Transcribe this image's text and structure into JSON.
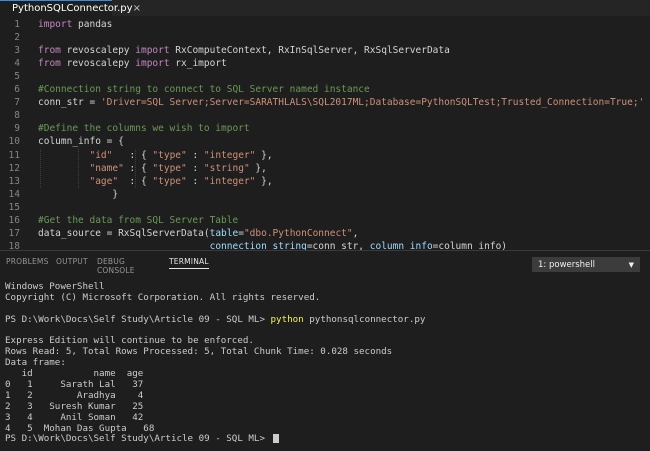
{
  "tab": {
    "title": "PythonSQLConnector.py",
    "close": "×"
  },
  "editor": {
    "line_numbers": [
      "1",
      "2",
      "3",
      "4",
      "5",
      "6",
      "7",
      "8",
      "9",
      "10",
      "11",
      "12",
      "13",
      "14",
      "15",
      "16",
      "17",
      "18"
    ],
    "lines": [
      [
        {
          "t": "import",
          "c": "kw"
        },
        {
          "t": " pandas",
          "c": ""
        }
      ],
      [],
      [
        {
          "t": "from",
          "c": "kw"
        },
        {
          "t": " revoscalepy ",
          "c": ""
        },
        {
          "t": "import",
          "c": "kw"
        },
        {
          "t": " RxComputeContext, RxInSqlServer, RxSqlServerData",
          "c": ""
        }
      ],
      [
        {
          "t": "from",
          "c": "kw"
        },
        {
          "t": " revoscalepy ",
          "c": ""
        },
        {
          "t": "import",
          "c": "kw"
        },
        {
          "t": " rx_import",
          "c": ""
        }
      ],
      [],
      [
        {
          "t": "#Connection string to connect to SQL Server named instance",
          "c": "cm"
        }
      ],
      [
        {
          "t": "conn_str = ",
          "c": ""
        },
        {
          "t": "'Driver=SQL Server;Server=SARATHLALS\\SQL2017ML;Database=PythonSQLTest;Trusted_Connection=True;'",
          "c": "str"
        }
      ],
      [],
      [
        {
          "t": "#Define the columns we wish to import",
          "c": "cm"
        }
      ],
      [
        {
          "t": "column_info = {",
          "c": ""
        }
      ],
      [
        {
          "t": "         ",
          "c": ""
        },
        {
          "t": "\"id\"",
          "c": "str"
        },
        {
          "t": "   : { ",
          "c": ""
        },
        {
          "t": "\"type\"",
          "c": "str"
        },
        {
          "t": " : ",
          "c": ""
        },
        {
          "t": "\"integer\"",
          "c": "str"
        },
        {
          "t": " },",
          "c": ""
        }
      ],
      [
        {
          "t": "         ",
          "c": ""
        },
        {
          "t": "\"name\"",
          "c": "str"
        },
        {
          "t": " : { ",
          "c": ""
        },
        {
          "t": "\"type\"",
          "c": "str"
        },
        {
          "t": " : ",
          "c": ""
        },
        {
          "t": "\"string\"",
          "c": "str"
        },
        {
          "t": " },",
          "c": ""
        }
      ],
      [
        {
          "t": "         ",
          "c": ""
        },
        {
          "t": "\"age\"",
          "c": "str"
        },
        {
          "t": "  : { ",
          "c": ""
        },
        {
          "t": "\"type\"",
          "c": "str"
        },
        {
          "t": " : ",
          "c": ""
        },
        {
          "t": "\"integer\"",
          "c": "str"
        },
        {
          "t": " },",
          "c": ""
        }
      ],
      [
        {
          "t": "             }",
          "c": ""
        }
      ],
      [],
      [
        {
          "t": "#Get the data from SQL Server Table",
          "c": "cm"
        }
      ],
      [
        {
          "t": "data_source = RxSqlServerData(",
          "c": ""
        },
        {
          "t": "table",
          "c": "par"
        },
        {
          "t": "=",
          "c": ""
        },
        {
          "t": "\"dbo.PythonConnect\"",
          "c": "str"
        },
        {
          "t": ",",
          "c": ""
        }
      ],
      [
        {
          "t": "                              ",
          "c": ""
        },
        {
          "t": "connection_string",
          "c": "par"
        },
        {
          "t": "=conn_str, ",
          "c": ""
        },
        {
          "t": "column_info",
          "c": "par"
        },
        {
          "t": "=column_info)",
          "c": ""
        }
      ]
    ]
  },
  "panel": {
    "tabs": [
      "PROBLEMS",
      "OUTPUT",
      "DEBUG CONSOLE",
      "TERMINAL"
    ],
    "active_tab": "TERMINAL",
    "terminal_select": "1: powershell",
    "terminal_lines": [
      "Windows PowerShell",
      "Copyright (C) Microsoft Corporation. All rights reserved.",
      "",
      "PS D:\\Work\\Docs\\Self Study\\Article 09 - SQL ML> ",
      "",
      "Express Edition will continue to be enforced.",
      "Rows Read: 5, Total Rows Processed: 5, Total Chunk Time: 0.028 seconds",
      "Data frame:",
      "   id           name  age",
      "0   1     Sarath Lal   37",
      "1   2        Aradhya    4",
      "2   3   Suresh Kumar   25",
      "3   4     Anil Soman   42",
      "4   5  Mohan Das Gupta   68",
      "PS D:\\Work\\Docs\\Self Study\\Article 09 - SQL ML> "
    ],
    "command_keyword": "python",
    "command_arg": " pythonsqlconnector.py"
  }
}
